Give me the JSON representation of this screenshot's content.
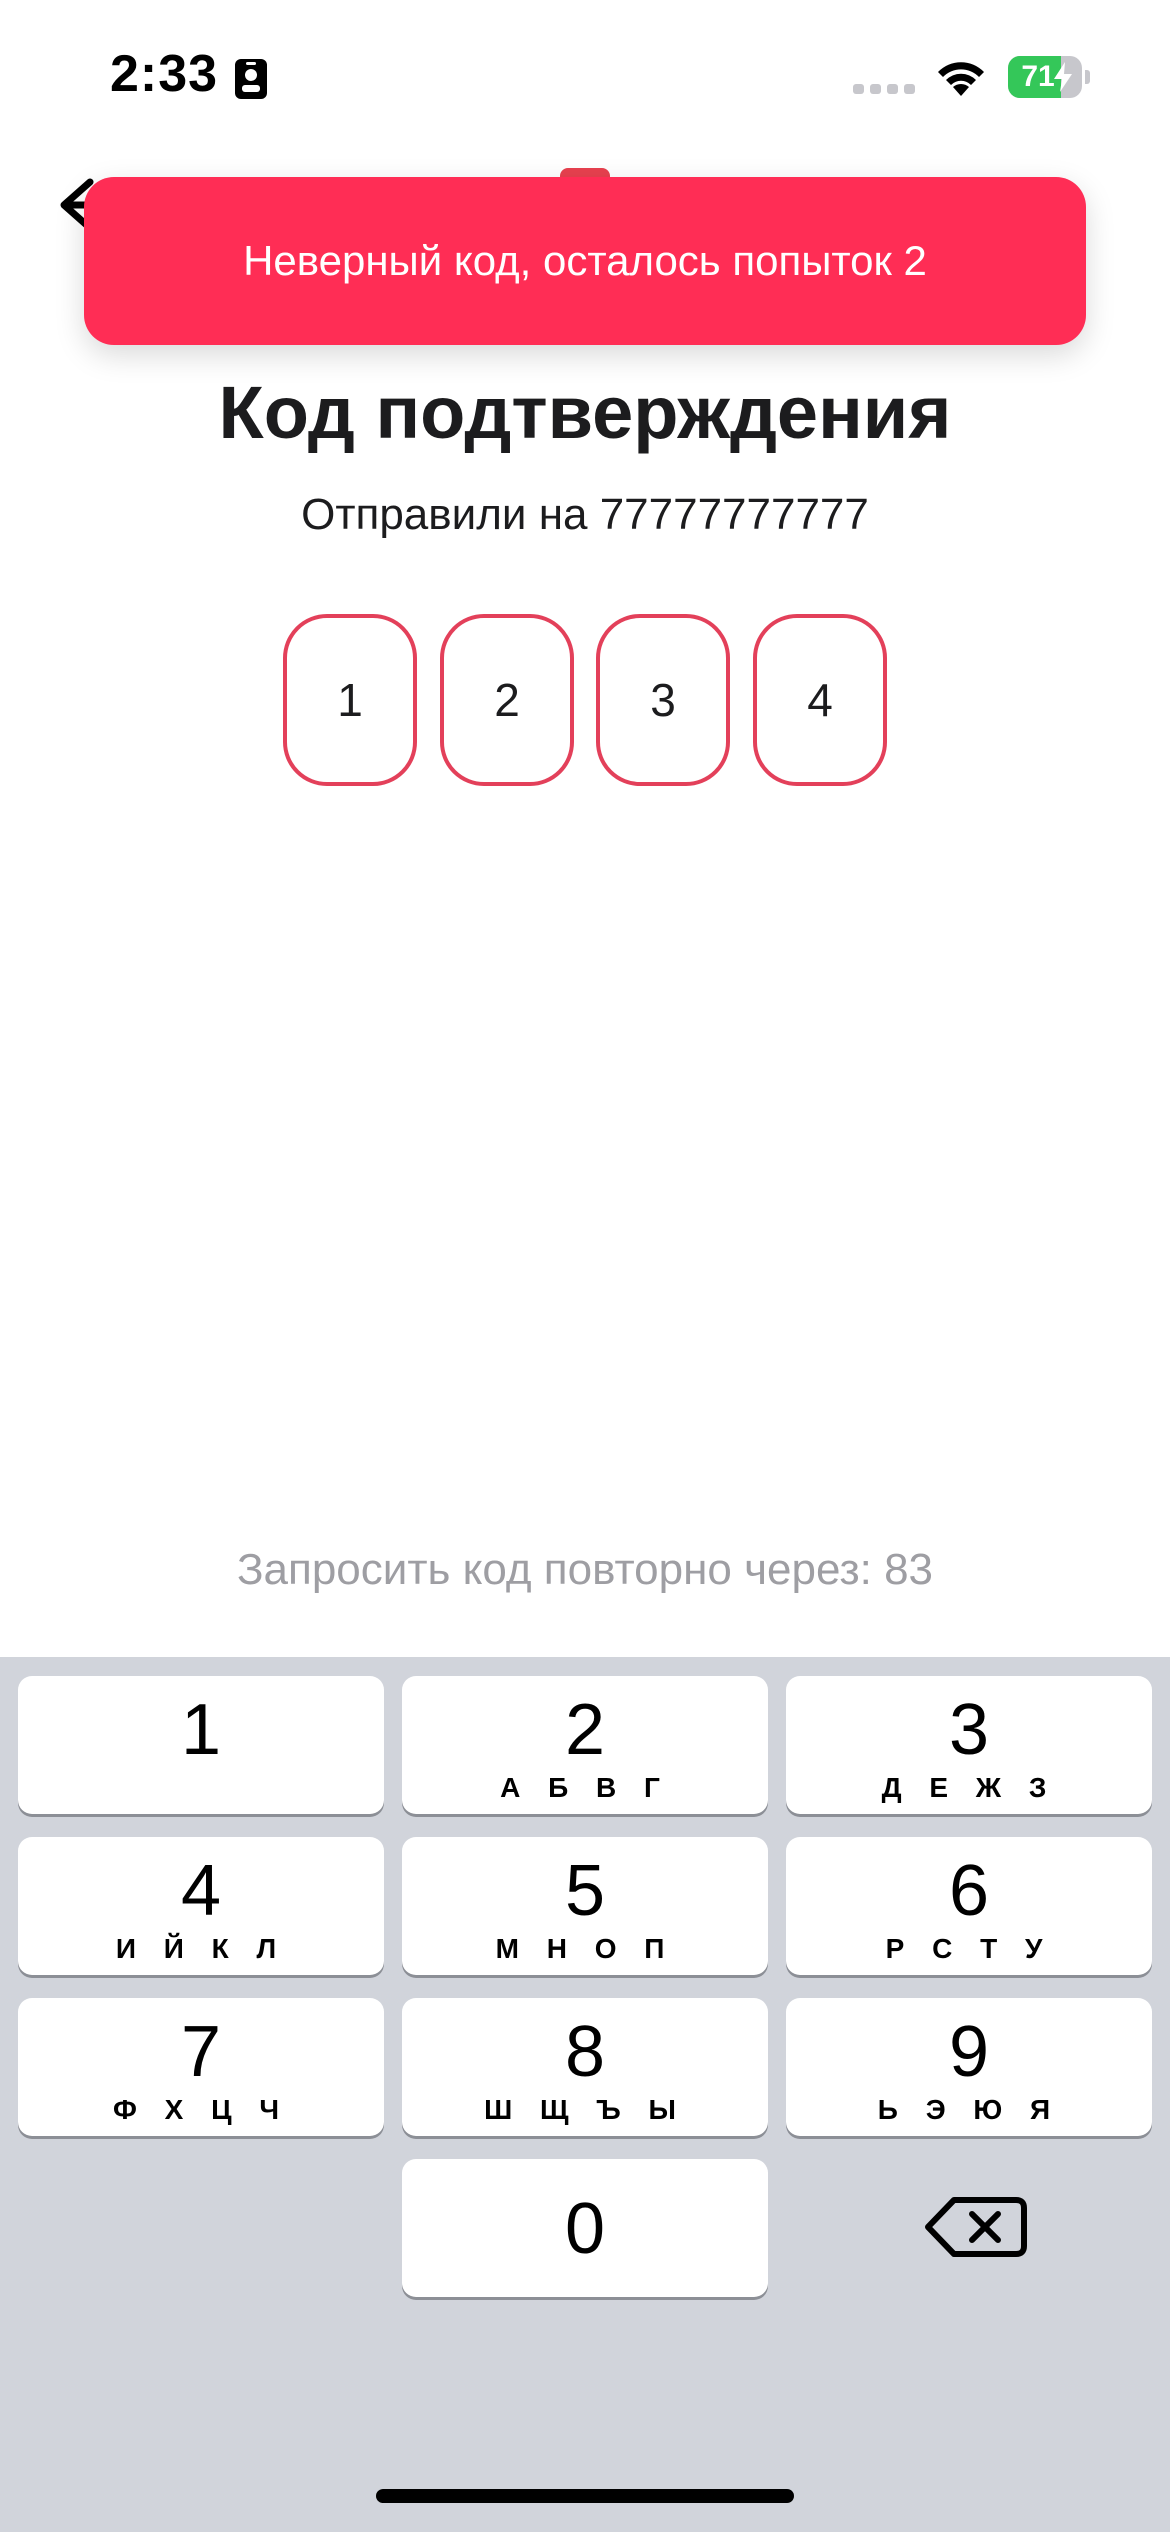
{
  "status_bar": {
    "time": "2:33",
    "battery_percent": "71",
    "battery_level": 0.71,
    "battery_color": "#34c759"
  },
  "icons": {
    "back": "arrow-left-icon",
    "focus": "person-badge-icon",
    "signal": "cellular-signal-icon",
    "wifi": "wifi-icon",
    "bolt": "charging-bolt-icon",
    "delete": "backspace-icon"
  },
  "toast": {
    "message": "Неверный код, осталось попыток 2",
    "color": "#ff2d55"
  },
  "main": {
    "title": "Код подтверждения",
    "subtitle": "Отправили на 77777777777",
    "code_digits": [
      "1",
      "2",
      "3",
      "4"
    ],
    "resend_text": "Запросить код повторно через: 83",
    "accent_color": "#e3405a"
  },
  "keyboard": {
    "keys": [
      {
        "digit": "1",
        "letters": ""
      },
      {
        "digit": "2",
        "letters": "А Б В Г"
      },
      {
        "digit": "3",
        "letters": "Д Е Ж З"
      },
      {
        "digit": "4",
        "letters": "И Й К Л"
      },
      {
        "digit": "5",
        "letters": "М Н О П"
      },
      {
        "digit": "6",
        "letters": "Р С Т У"
      },
      {
        "digit": "7",
        "letters": "Ф Х Ц Ч"
      },
      {
        "digit": "8",
        "letters": "Ш Щ Ъ Ы"
      },
      {
        "digit": "9",
        "letters": "Ь Э Ю Я"
      },
      {
        "digit": "0",
        "letters": ""
      }
    ]
  }
}
